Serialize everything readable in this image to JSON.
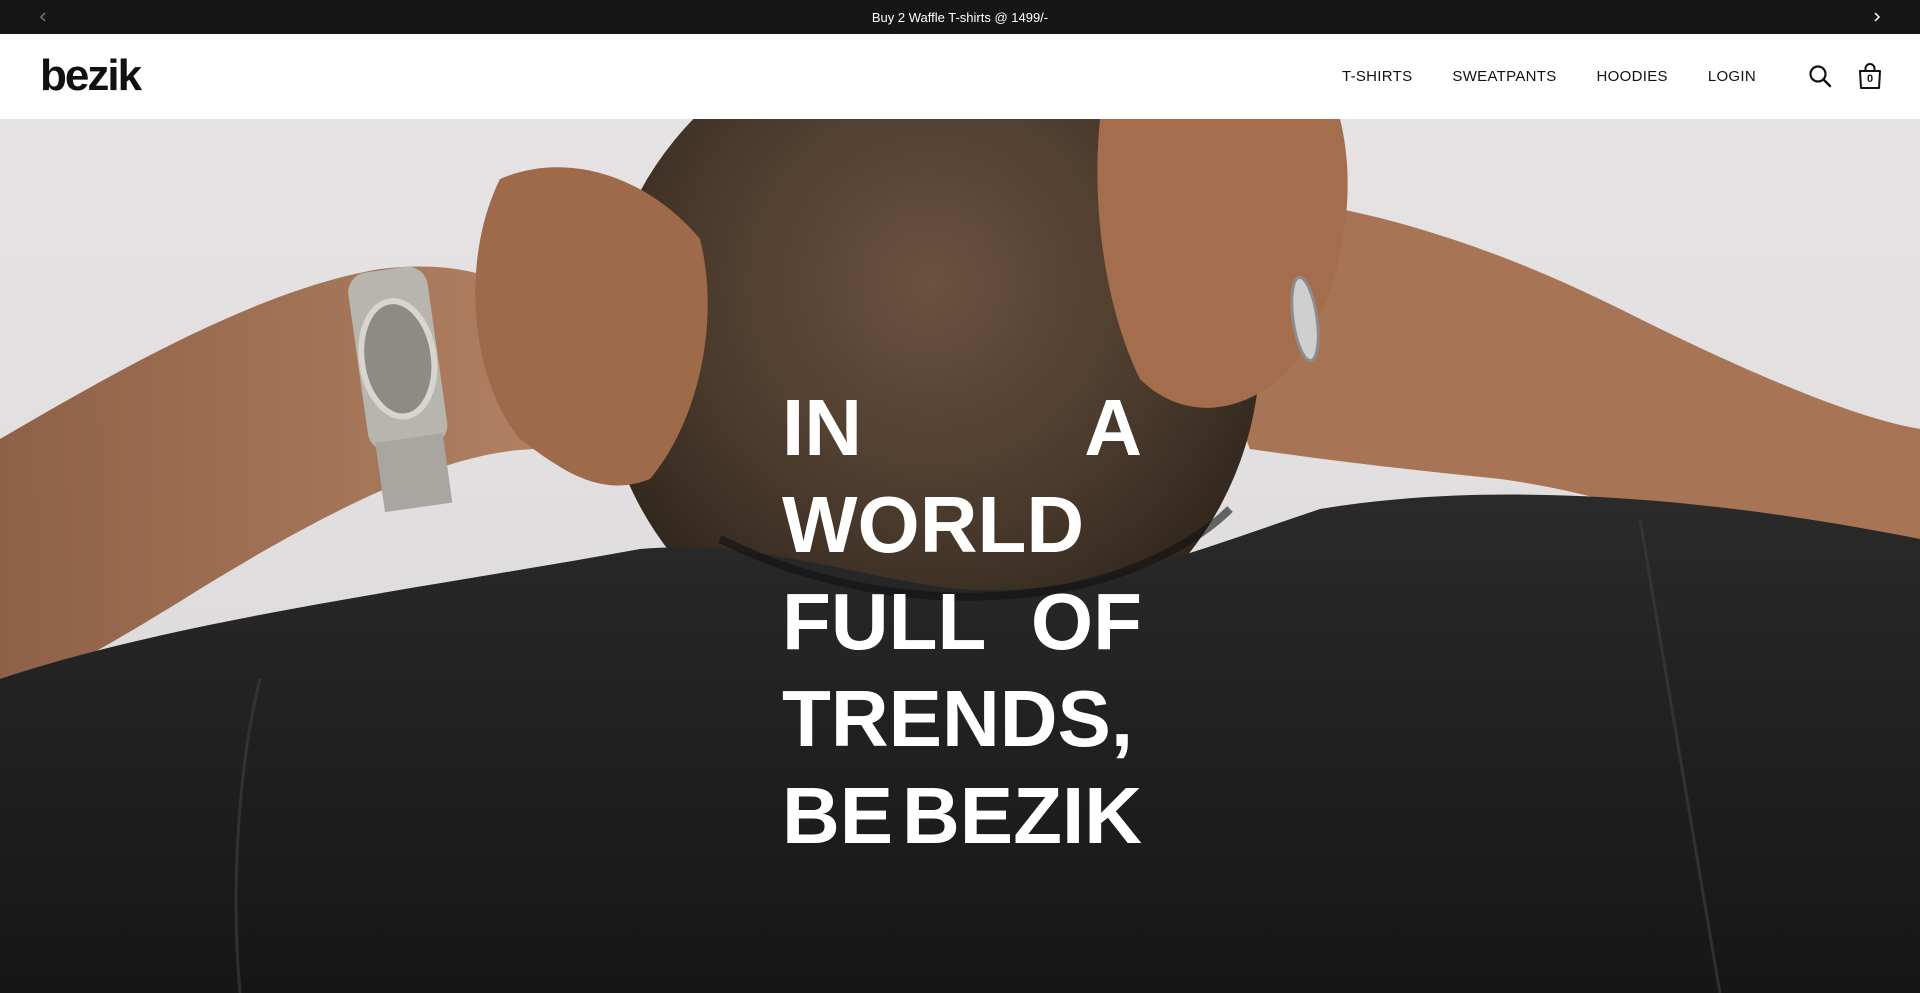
{
  "announcement": {
    "text": "Buy 2 Waffle T-shirts @ 1499/-",
    "prev_icon": "chevron-left-icon",
    "next_icon": "chevron-right-icon"
  },
  "header": {
    "logo": "bezik",
    "nav": [
      {
        "label": "T-SHIRTS"
      },
      {
        "label": "SWEATPANTS"
      },
      {
        "label": "HOODIES"
      },
      {
        "label": "LOGIN"
      }
    ],
    "search_icon": "search-icon",
    "cart_icon": "bag-icon",
    "cart_count": "0"
  },
  "hero": {
    "lines": [
      [
        "IN",
        "A"
      ],
      [
        "WORLD"
      ],
      [
        "FULL",
        "OF"
      ],
      [
        "TRENDS,"
      ],
      [
        "BE",
        "BEZIK"
      ]
    ],
    "colors": {
      "background": "#e4e1e2",
      "shirt": "#202020",
      "skin": "#9a6a4c",
      "hair": "#4a3a2c",
      "text": "#ffffff"
    }
  }
}
